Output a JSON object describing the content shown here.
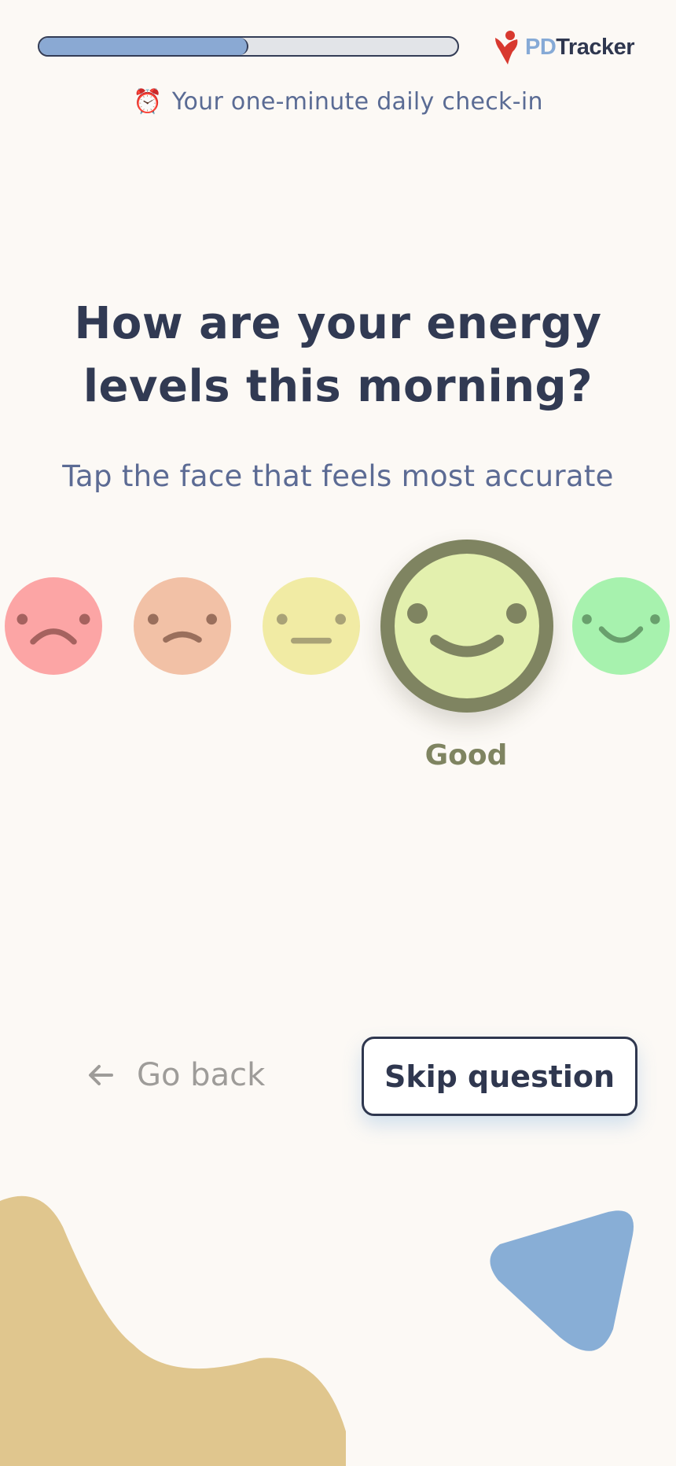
{
  "header": {
    "progress_fraction": 0.5,
    "logo": {
      "pd": "PD",
      "tracker": "Tracker"
    },
    "subtitle": {
      "icon": "alarm-clock-icon",
      "emoji": "⏰",
      "text": "Your one-minute daily check-in"
    }
  },
  "question": {
    "title": "How are your energy levels this morning?",
    "hint": "Tap the face that feels most accurate"
  },
  "moods": {
    "selected_label": "Good",
    "options": [
      {
        "name": "very-low",
        "color": "#fca5a5"
      },
      {
        "name": "low",
        "color": "#f2c1a6"
      },
      {
        "name": "neutral",
        "color": "#f1eba4"
      },
      {
        "name": "good",
        "color": "#e3f0ae",
        "selected": true
      },
      {
        "name": "great",
        "color": "#a7f2ae"
      }
    ]
  },
  "actions": {
    "back_label": "Go back",
    "skip_label": "Skip question"
  },
  "colors": {
    "background": "#fcf9f5",
    "progress_fill": "#8aa9d3",
    "heading": "#313a53",
    "accent_blue": "#86aad6",
    "blob_tan": "#e0c68e",
    "triangle_blue": "#88aed6"
  }
}
